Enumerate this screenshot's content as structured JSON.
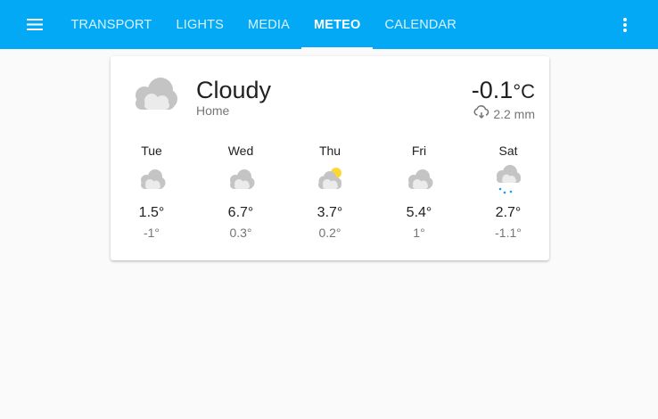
{
  "toolbar": {
    "menu_icon": "hamburger-menu-icon",
    "more_icon": "more-vertical-icon",
    "background": "#03a9f4",
    "tabs": [
      {
        "label": "TRANSPORT",
        "active": false
      },
      {
        "label": "LIGHTS",
        "active": false
      },
      {
        "label": "MEDIA",
        "active": false
      },
      {
        "label": "METEO",
        "active": true
      },
      {
        "label": "CALENDAR",
        "active": false
      }
    ]
  },
  "weather": {
    "icon": "cloudy-icon",
    "condition": "Cloudy",
    "location": "Home",
    "temperature": "-0.1",
    "unit": "°C",
    "precip_icon": "rain-cloud-icon",
    "precipitation": "2.2 mm",
    "forecast": [
      {
        "day": "Tue",
        "icon": "cloudy-icon",
        "high": "1.5°",
        "low": "-1°"
      },
      {
        "day": "Wed",
        "icon": "cloudy-icon",
        "high": "6.7°",
        "low": "0.3°"
      },
      {
        "day": "Thu",
        "icon": "partly-cloudy-icon",
        "high": "3.7°",
        "low": "0.2°"
      },
      {
        "day": "Fri",
        "icon": "cloudy-icon",
        "high": "5.4°",
        "low": "1°"
      },
      {
        "day": "Sat",
        "icon": "snowy-icon",
        "high": "2.7°",
        "low": "-1.1°"
      }
    ]
  }
}
